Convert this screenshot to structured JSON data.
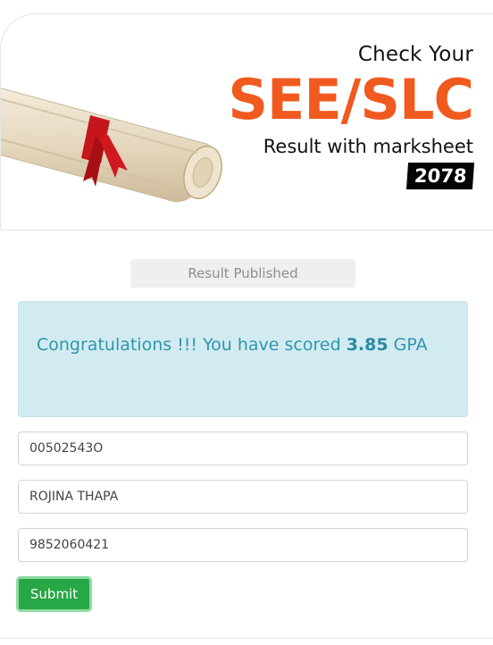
{
  "header": {
    "check_your": "Check Your",
    "see_slc": "SEE/SLC",
    "result_with": "Result with marksheet",
    "year": "2078"
  },
  "status": {
    "label": "Result Published"
  },
  "alert": {
    "prefix": "Congratulations !!! You have scored",
    "gpa": "3.85",
    "suffix": "GPA"
  },
  "form": {
    "symbol_number": "00502543O",
    "name": "ROJINA THAPA",
    "phone": "9852060421",
    "submit_label": "Submit"
  },
  "colors": {
    "accent_orange": "#f15a1f",
    "alert_text": "#2f96ad",
    "alert_bg": "#d2ebf1",
    "submit_green": "#27a745"
  }
}
